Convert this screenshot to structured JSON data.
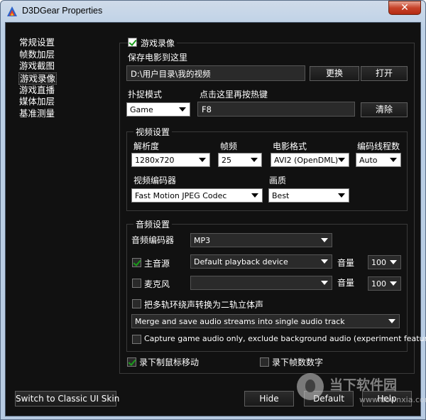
{
  "window": {
    "title": "D3DGear Properties",
    "close_label": "✕"
  },
  "nav": {
    "items": [
      {
        "label": "常规设置",
        "active": false
      },
      {
        "label": "帧数加层",
        "active": false
      },
      {
        "label": "游戏截图",
        "active": false
      },
      {
        "label": "游戏录像",
        "active": true
      },
      {
        "label": "游戏直播",
        "active": false
      },
      {
        "label": "媒体加层",
        "active": false
      },
      {
        "label": "基准测量",
        "active": false
      }
    ]
  },
  "recording": {
    "enable_label": "游戏录像",
    "enabled": true,
    "save_to_label": "保存电影到这里",
    "save_path": "D:\\用户目录\\我的视频",
    "change_label": "更换",
    "open_label": "打开",
    "capture_mode_label": "扑捉模式",
    "capture_mode": "Game",
    "hotkey_label": "点击这里再按热键",
    "hotkey": "F8",
    "clear_label": "清除"
  },
  "video": {
    "group_label": "视频设置",
    "resolution_label": "解析度",
    "resolution": "1280x720",
    "fps_label": "帧频",
    "fps": "25",
    "format_label": "电影格式",
    "format": "AVI2 (OpenDML)",
    "threads_label": "编码线程数",
    "threads": "Auto",
    "encoder_label": "视频编码器",
    "encoder": "Fast Motion JPEG Codec",
    "quality_label": "画质",
    "quality": "Best"
  },
  "audio": {
    "group_label": "音频设置",
    "encoder_label": "音频编码器",
    "encoder": "MP3",
    "main_source_label": "主音源",
    "main_source_checked": true,
    "main_source_device": "Default playback device",
    "volume_label": "音量",
    "main_volume": "100",
    "mic_label": "麦克风",
    "mic_checked": false,
    "mic_device": "",
    "mic_volume": "100",
    "downmix_label": "把多轨环绕声转换为二轨立体声",
    "downmix_checked": false,
    "merge_option": "Merge and save audio streams into single audio track",
    "capture_game_only_label": "Capture game audio only, exclude background audio (experiment feature).",
    "capture_game_only_checked": false
  },
  "options": {
    "record_mouse_label": "录下制鼠标移动",
    "record_mouse_checked": true,
    "record_fps_label": "录下帧数数字",
    "record_fps_checked": false
  },
  "footer": {
    "classic_skin_label": "Switch to Classic UI Skin",
    "hide_label": "Hide",
    "default_label": "Default",
    "help_label": "Help"
  },
  "watermark": {
    "text": "当下软件园",
    "url": "www.downxia.com"
  },
  "colors": {
    "client_bg": "#111111",
    "check_green": "#1a9d1a",
    "titlebar": "#bcd0e6"
  }
}
